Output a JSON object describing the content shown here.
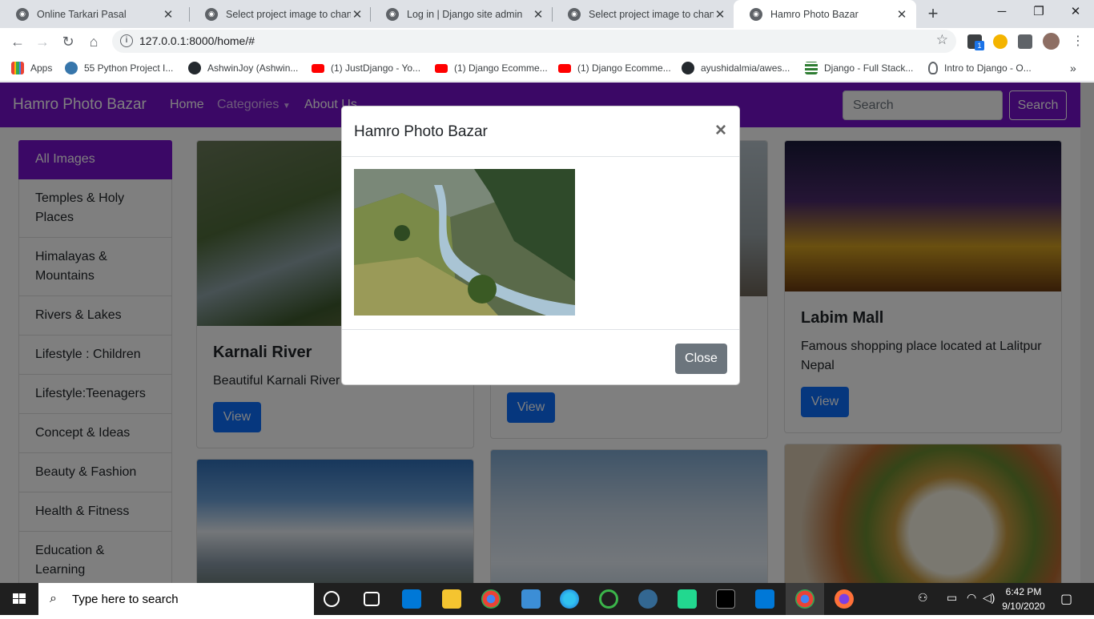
{
  "browser": {
    "tabs": [
      {
        "label": "Online Tarkari Pasal",
        "active": false
      },
      {
        "label": "Select project image to change",
        "active": false
      },
      {
        "label": "Log in | Django site admin",
        "active": false
      },
      {
        "label": "Select project image to change",
        "active": false
      },
      {
        "label": "Hamro Photo Bazar",
        "active": true
      }
    ],
    "url": "127.0.0.1:8000/home/#",
    "bookmarks": [
      "Apps",
      "55 Python Project I...",
      "AshwinJoy (Ashwin...",
      "(1) JustDjango - Yo...",
      "(1) Django Ecomme...",
      "(1) Django Ecomme...",
      "ayushidalmia/awes...",
      "Django - Full Stack...",
      "Intro to Django - O..."
    ],
    "ext_badge": "1"
  },
  "site": {
    "brand": "Hamro Photo Bazar",
    "nav": {
      "home": "Home",
      "categories": "Categories",
      "about": "About Us"
    },
    "search": {
      "placeholder": "Search",
      "button": "Search"
    },
    "sidebar": [
      "All Images",
      "Temples & Holy Places",
      "Himalayas & Mountains",
      "Rivers & Lakes",
      "Lifestyle : Children",
      "Lifestyle:Teenagers",
      "Concept & Ideas",
      "Beauty & Fashion",
      "Health & Fitness",
      "Education & Learning"
    ],
    "cards": [
      {
        "title": "Karnali River",
        "text": "Beautiful Karnali River",
        "button": "View"
      },
      {
        "title": "",
        "text": "",
        "button": "View"
      },
      {
        "title": "Labim Mall",
        "text": "Famous shopping place located at Lalitpur Nepal",
        "button": "View"
      }
    ]
  },
  "modal": {
    "title": "Hamro Photo Bazar",
    "close_x": "×",
    "close_button": "Close"
  },
  "taskbar": {
    "search_placeholder": "Type here to search",
    "time": "6:42 PM",
    "date": "9/10/2020"
  },
  "colors": {
    "brand": "#7710cc",
    "primary": "#0d6efd",
    "secondary": "#6c757d"
  }
}
